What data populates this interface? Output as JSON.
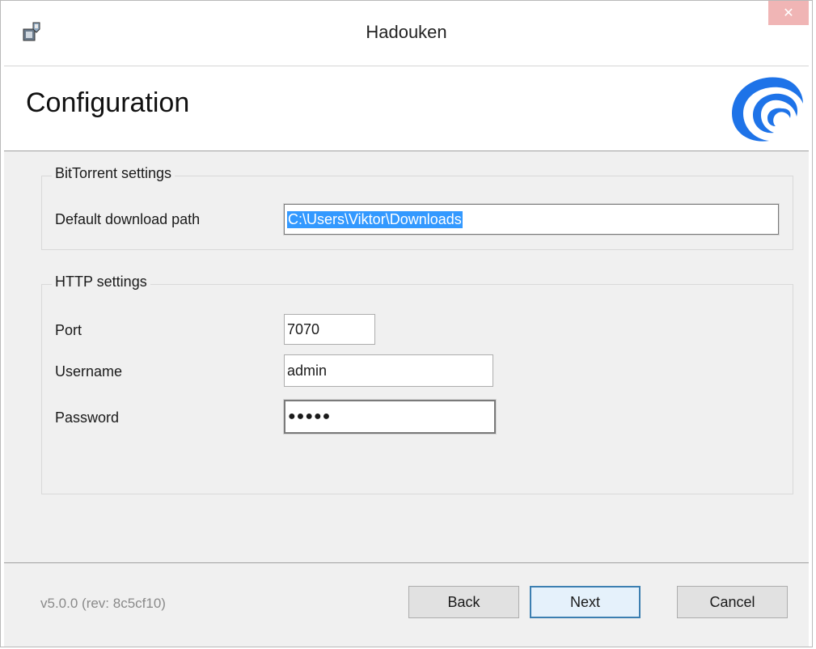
{
  "window": {
    "title": "Hadouken",
    "close_glyph": "✕",
    "icon": "installer-app-icon"
  },
  "banner": {
    "title": "Configuration",
    "logo": "hadouken-wave-logo",
    "logo_color": "#1e73e8"
  },
  "bittorrent": {
    "legend": "BitTorrent settings",
    "download_path_label": "Default download path",
    "download_path_value": "C:\\Users\\Viktor\\Downloads"
  },
  "http": {
    "legend": "HTTP settings",
    "port_label": "Port",
    "port_value": "7070",
    "username_label": "Username",
    "username_value": "admin",
    "password_label": "Password",
    "password_value": "●●●●●"
  },
  "footer": {
    "version": "v5.0.0 (rev: 8c5cf10)",
    "back_label": "Back",
    "next_label": "Next",
    "cancel_label": "Cancel"
  },
  "colors": {
    "selection": "#3399ff",
    "default_button_border": "#3c7fb1"
  }
}
